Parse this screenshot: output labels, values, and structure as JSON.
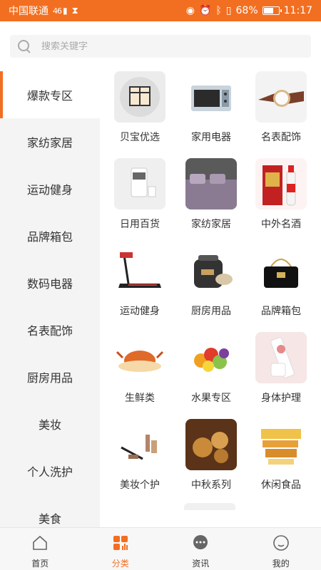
{
  "status_bar": {
    "carrier": "中国联通",
    "signal": "46",
    "battery_pct": "68%",
    "battery_level": 0.68,
    "time": "11:17"
  },
  "search": {
    "placeholder": "搜索关键字"
  },
  "sidebar": {
    "items": [
      {
        "label": "爆款专区",
        "active": true
      },
      {
        "label": "家纺家居"
      },
      {
        "label": "运动健身"
      },
      {
        "label": "品牌箱包"
      },
      {
        "label": "数码电器"
      },
      {
        "label": "名表配饰"
      },
      {
        "label": "厨房用品"
      },
      {
        "label": "美妆"
      },
      {
        "label": "个人洗护"
      },
      {
        "label": "美食"
      }
    ]
  },
  "categories": [
    {
      "label": "贝宝优选",
      "icon": "box-icon"
    },
    {
      "label": "家用电器",
      "icon": "oven-icon"
    },
    {
      "label": "名表配饰",
      "icon": "watch-icon"
    },
    {
      "label": "日用百货",
      "icon": "kettle-icon"
    },
    {
      "label": "家纺家居",
      "icon": "bedding-icon"
    },
    {
      "label": "中外名酒",
      "icon": "liquor-icon"
    },
    {
      "label": "运动健身",
      "icon": "treadmill-icon"
    },
    {
      "label": "厨房用品",
      "icon": "cooker-icon"
    },
    {
      "label": "品牌箱包",
      "icon": "handbag-icon"
    },
    {
      "label": "生鲜类",
      "icon": "crab-icon"
    },
    {
      "label": "水果专区",
      "icon": "fruit-icon"
    },
    {
      "label": "身体护理",
      "icon": "lotion-icon"
    },
    {
      "label": "美妆个护",
      "icon": "makeup-icon"
    },
    {
      "label": "中秋系列",
      "icon": "mooncake-icon"
    },
    {
      "label": "休闲食品",
      "icon": "snacks-icon"
    }
  ],
  "tabbar": {
    "tabs": [
      {
        "label": "首页",
        "icon": "home-icon"
      },
      {
        "label": "分类",
        "icon": "category-icon",
        "active": true
      },
      {
        "label": "资讯",
        "icon": "chat-icon"
      },
      {
        "label": "我的",
        "icon": "profile-icon"
      }
    ]
  },
  "colors": {
    "accent": "#f26f21",
    "sidebar_bg": "#f4f4f4"
  }
}
